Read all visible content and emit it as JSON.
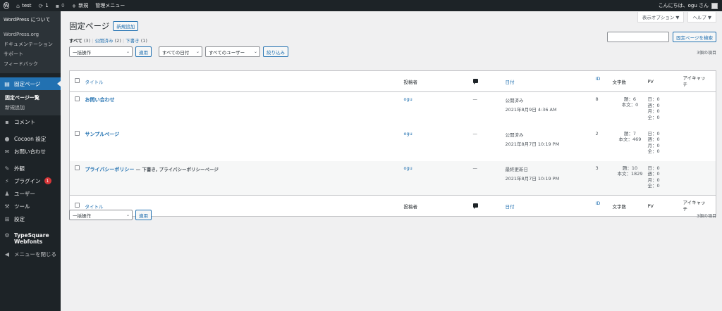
{
  "adminbar": {
    "wp_logo": "W",
    "site_name": "test",
    "updates_count": "1",
    "comments_count": "0",
    "new_label": "新規",
    "admin_menu_label": "管理メニュー",
    "greeting": "こんにちは、ogu さん",
    "icons": {
      "home": "home-icon",
      "updates": "refresh-icon",
      "comments": "comment-icon",
      "new": "plus-icon"
    }
  },
  "sidebar": {
    "about": {
      "head": "WordPress について",
      "items": [
        "WordPress.org",
        "ドキュメンテーション",
        "サポート",
        "フィードバック"
      ]
    },
    "pages_label": "固定ページ",
    "pages_sub": [
      "固定ページ一覧",
      "新規追加"
    ],
    "menu": [
      {
        "label": "コメント",
        "icon": "comment-icon"
      },
      {
        "label": "Cocoon 設定",
        "icon": "cocoon-icon"
      },
      {
        "label": "お問い合わせ",
        "icon": "mail-icon"
      },
      {
        "label": "外観",
        "icon": "brush-icon"
      },
      {
        "label": "プラグイン",
        "icon": "plugin-icon",
        "badge": "1"
      },
      {
        "label": "ユーザー",
        "icon": "user-icon"
      },
      {
        "label": "ツール",
        "icon": "wrench-icon"
      },
      {
        "label": "設定",
        "icon": "settings-icon"
      }
    ],
    "typesquare": "TypeSquare Webfonts",
    "collapse": "メニューを閉じる"
  },
  "screen_meta": {
    "options": "表示オプション ▼",
    "help": "ヘルプ ▼"
  },
  "page": {
    "title": "固定ページ",
    "add_new": "新規追加",
    "filters": {
      "all": "すべて",
      "all_count": "(3)",
      "published": "公開済み",
      "published_count": "(2)",
      "draft": "下書き",
      "draft_count": "(1)",
      "sep": "|"
    },
    "search_button": "固定ページを検索",
    "bulk_action": "一括操作",
    "apply": "適用",
    "all_dates": "すべての日付",
    "all_users": "すべてのユーザー",
    "filter_button": "絞り込み",
    "items_count": "3個の項目"
  },
  "table": {
    "headers": {
      "title": "タイトル",
      "author": "投稿者",
      "date": "日付",
      "id": "ID",
      "word_count": "文字数",
      "pv": "PV",
      "eyecatch": "アイキャッチ"
    },
    "rows": [
      {
        "title": "お問い合わせ",
        "state": "",
        "author": "ogu",
        "comments": "—",
        "status": "公開済み",
        "date": "2021年8月9日 4:36 AM",
        "id": "8",
        "wc_title": "題：6",
        "wc_body": "本文：0",
        "pv": [
          "日：0",
          "週：0",
          "月：0",
          "全：0"
        ]
      },
      {
        "title": "サンプルページ",
        "state": "",
        "author": "ogu",
        "comments": "—",
        "status": "公開済み",
        "date": "2021年8月7日 10:19 PM",
        "id": "2",
        "wc_title": "題：7",
        "wc_body": "本文：469",
        "pv": [
          "日：0",
          "週：0",
          "月：0",
          "全：0"
        ]
      },
      {
        "title": "プライバシーポリシー",
        "state": " — 下書き, プライバシーポリシーページ",
        "author": "ogu",
        "comments": "—",
        "status": "最終更新日",
        "date": "2021年8月7日 10:19 PM",
        "id": "3",
        "wc_title": "題：10",
        "wc_body": "本文：1829",
        "pv": [
          "日：0",
          "週：0",
          "月：0",
          "全：0"
        ]
      }
    ]
  },
  "colors": {
    "accent": "#2271b1",
    "adminbar": "#1d2327",
    "badge": "#d63638"
  }
}
